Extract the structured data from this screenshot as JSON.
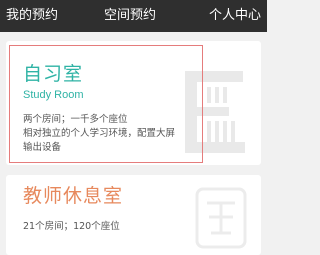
{
  "nav": {
    "left": "我的预约",
    "center": "空间预约",
    "right": "个人中心"
  },
  "rooms": [
    {
      "title": "自习室",
      "subtitle": "Study Room",
      "lines": [
        "两个房间；一千多个座位",
        "相对独立的个人学习环境，配置大屏",
        "输出设备"
      ],
      "accent": "#2fb3a5",
      "icon": "letter-e-watermark-icon"
    },
    {
      "title": "教师休息室",
      "lines": [
        "21个房间；120个座位"
      ],
      "accent": "#e7895d",
      "icon": "seal-watermark-icon"
    }
  ]
}
